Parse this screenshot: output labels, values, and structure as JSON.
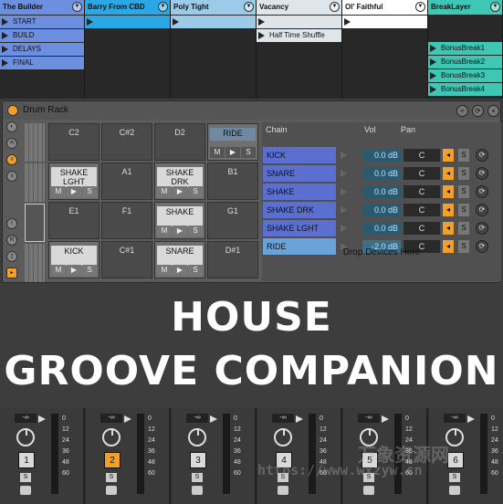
{
  "session": {
    "tracks": [
      {
        "name": "The Builder",
        "header_color": "#6d8fe0",
        "slot_color": "#6d8fe0",
        "clips": [
          "START",
          "BUILD",
          "DELAYS",
          "FINAL"
        ]
      },
      {
        "name": "Barry From CBD",
        "header_color": "#2aa8e6",
        "slot_color": "#2aa8e6",
        "clips": [
          ""
        ]
      },
      {
        "name": "Poly Tight",
        "header_color": "#9bcbe8",
        "slot_color": "#9bcbe8",
        "clips": [
          ""
        ]
      },
      {
        "name": "Vacancy",
        "header_color": "#dfe6ea",
        "slot_color": "#dfe6ea",
        "clips": [
          "",
          "Half Time Shuffle"
        ]
      },
      {
        "name": "Ol' Faithful",
        "header_color": "#ffffff",
        "slot_color": "#ffffff",
        "clips": [
          ""
        ]
      },
      {
        "name": "BreakLayer",
        "header_color": "#3ec7b5",
        "slot_color": "#3ec7b5",
        "clips": [
          "BonusBreak1",
          "BonusBreak2",
          "BonusBreak3",
          "BonusBreak4"
        ]
      }
    ]
  },
  "drum_rack": {
    "title": "Drum Rack",
    "pads": [
      {
        "note": "C2",
        "sample": ""
      },
      {
        "note": "C#2",
        "sample": ""
      },
      {
        "note": "D2",
        "sample": ""
      },
      {
        "note": "RIDE",
        "sample": "RIDE"
      },
      {
        "note": "",
        "sample": "SHAKE LGHT"
      },
      {
        "note": "A1",
        "sample": ""
      },
      {
        "note": "",
        "sample": "SHAKE DRK"
      },
      {
        "note": "B1",
        "sample": ""
      },
      {
        "note": "E1",
        "sample": ""
      },
      {
        "note": "F1",
        "sample": ""
      },
      {
        "note": "",
        "sample": "SHAKE"
      },
      {
        "note": "G1",
        "sample": ""
      },
      {
        "note": "",
        "sample": "KICK"
      },
      {
        "note": "C#1",
        "sample": ""
      },
      {
        "note": "",
        "sample": "SNARE"
      },
      {
        "note": "D#1",
        "sample": ""
      }
    ],
    "pad_buttons": [
      "M",
      "▶",
      "S"
    ],
    "chain_header": {
      "chain": "Chain",
      "vol": "Vol",
      "pan": "Pan"
    },
    "chains": [
      {
        "name": "KICK",
        "vol": "0.0 dB",
        "pan": "C"
      },
      {
        "name": "SNARE",
        "vol": "0.0 dB",
        "pan": "C"
      },
      {
        "name": "SHAKE",
        "vol": "0.0 dB",
        "pan": "C"
      },
      {
        "name": "SHAKE DRK",
        "vol": "0.0 dB",
        "pan": "C"
      },
      {
        "name": "SHAKE LGHT",
        "vol": "0.0 dB",
        "pan": "C"
      },
      {
        "name": "RIDE",
        "vol": "-2.0 dB",
        "pan": "C"
      }
    ],
    "solo_label": "S",
    "drop_text": "Drop Devices Here"
  },
  "overlay_title": {
    "line1": "HOUSE",
    "line2": "GROOVE COMPANION"
  },
  "mixer": {
    "strips": [
      {
        "db": "-∞",
        "num": "1",
        "active": false,
        "solo": "S"
      },
      {
        "db": "-∞",
        "num": "2",
        "active": true,
        "solo": "S"
      },
      {
        "db": "-∞",
        "num": "3",
        "active": false,
        "solo": "S"
      },
      {
        "db": "-∞",
        "num": "4",
        "active": false,
        "solo": "S"
      },
      {
        "db": "-∞",
        "num": "5",
        "active": false,
        "solo": "S"
      },
      {
        "db": "-∞",
        "num": "6",
        "active": false,
        "solo": "S"
      }
    ],
    "scale": [
      "0",
      "12",
      "24",
      "36",
      "48",
      "60"
    ]
  },
  "watermark": {
    "cn": "万象资源网",
    "url": "https://www.wxzyw.cn"
  }
}
